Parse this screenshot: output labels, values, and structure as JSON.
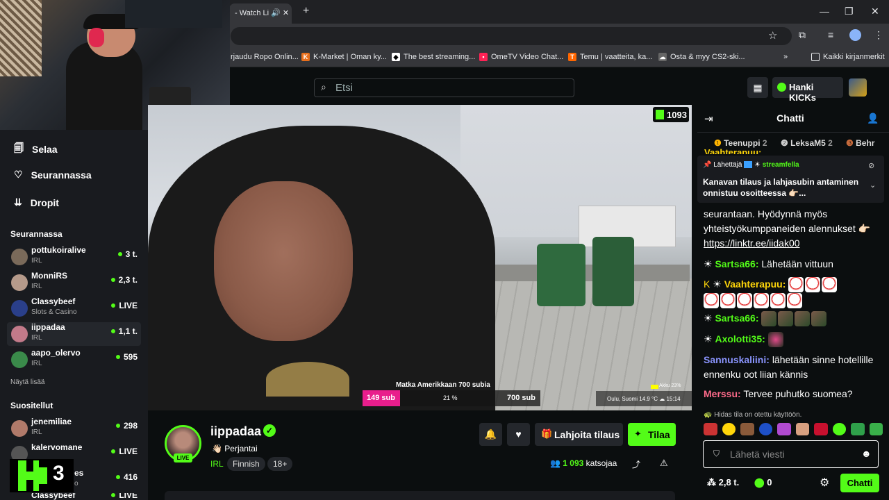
{
  "browser": {
    "tab_title": "- Watch Li",
    "bookmarks": [
      "rjaudu Ropo Onlin...",
      "K-Market | Oman ky...",
      "The best streaming...",
      "OmeTV Video Chat...",
      "Temu | vaatteita, ka...",
      "Osta & myy CS2-ski...",
      "Kaikki kirjanmerkit"
    ]
  },
  "header": {
    "search_placeholder": "Etsi",
    "kicks_button": "Hanki KICKs"
  },
  "sidebar": {
    "nav": [
      {
        "label": "Selaa",
        "icon": "browse-icon"
      },
      {
        "label": "Seurannassa",
        "icon": "heart-icon"
      },
      {
        "label": "Dropit",
        "icon": "drops-icon"
      }
    ],
    "following_title": "Seurannassa",
    "following": [
      {
        "name": "pottukoiralive",
        "category": "IRL",
        "viewers": "3 t."
      },
      {
        "name": "MonniRS",
        "category": "IRL",
        "viewers": "2,3 t."
      },
      {
        "name": "Classybeef",
        "category": "Slots & Casino",
        "viewers": "LIVE"
      },
      {
        "name": "iippadaa",
        "category": "IRL",
        "viewers": "1,1 t."
      },
      {
        "name": "aapo_olervo",
        "category": "IRL",
        "viewers": "595"
      }
    ],
    "show_more": "Näytä lisää",
    "recommended_title": "Suositellut",
    "recommended": [
      {
        "name": "jenemiliae",
        "category": "IRL",
        "viewers": "298"
      },
      {
        "name": "kalervomane",
        "category": "",
        "viewers": "LIVE"
      },
      {
        "name": "es",
        "category": "o",
        "viewers": "416"
      },
      {
        "name": "Classybeef",
        "category": "",
        "viewers": "LIVE"
      }
    ],
    "logo_badge": "3"
  },
  "player": {
    "viewer_badge": "1093",
    "overlay_goal": "Matka Amerikkaan 700 subia",
    "sub_count": "149 sub",
    "percent": "21 %",
    "goal_sub": "700 sub",
    "progress_fraction": 0.21,
    "location": "Oulu, Suomi",
    "temp": "14.9 °C",
    "time": "15:14",
    "battery": "Akku 23%"
  },
  "channel": {
    "name": "iippadaa",
    "stream_title": "Perjantai",
    "category": "IRL",
    "tags": [
      "Finnish",
      "18+"
    ],
    "live_label": "LIVE",
    "gift_button": "Lahjoita tilaus",
    "subscribe_button": "Tilaa",
    "viewers_count": "1 093",
    "viewers_label": "katsojaa"
  },
  "chat": {
    "title": "Chatti",
    "leaderboard": [
      {
        "rank": "1",
        "name": "Teenuppi",
        "count": "2"
      },
      {
        "rank": "2",
        "name": "LeksaM5",
        "count": "2"
      },
      {
        "rank": "3",
        "name": "Behr",
        "count": ""
      }
    ],
    "peek_name": "Vaahterapuu:",
    "pinned": {
      "sender_label": "Lähettäjä",
      "sender": "streamfella",
      "text": "Kanavan tilaus ja lahjasubin antaminen onnistuu osoitteessa 👉🏻..."
    },
    "messages": [
      {
        "user": "",
        "text": "seurantaan. Hyödynnä myös yhteistyökumppaneiden alennukset 👉🏻"
      },
      {
        "user": "",
        "text": "https://linktr.ee/iidak00"
      },
      {
        "user": "Sartsa66:",
        "text": "Lähetään vittuun"
      },
      {
        "user": "Vaahterapuu:",
        "text": ""
      },
      {
        "user": "Sartsa66:",
        "text": ""
      },
      {
        "user": "Axolotti35:",
        "text": ""
      },
      {
        "user": "Sannuskaliini:",
        "text": "lähetään sinne hotellille ennenku oot liian kännis"
      },
      {
        "user": "Merssu:",
        "text": "Tervee puhutko suomea?"
      }
    ],
    "slow_mode": "Hidas tila on otettu käyttöön.",
    "input_placeholder": "Lähetä viesti",
    "points": "2,8 t.",
    "kicks": "0",
    "send_button": "Chatti"
  },
  "colors": {
    "accent": "#53fc18",
    "bg": "#0b0e0f",
    "sidebar": "#191b1f",
    "pink": "#e91e8c"
  }
}
